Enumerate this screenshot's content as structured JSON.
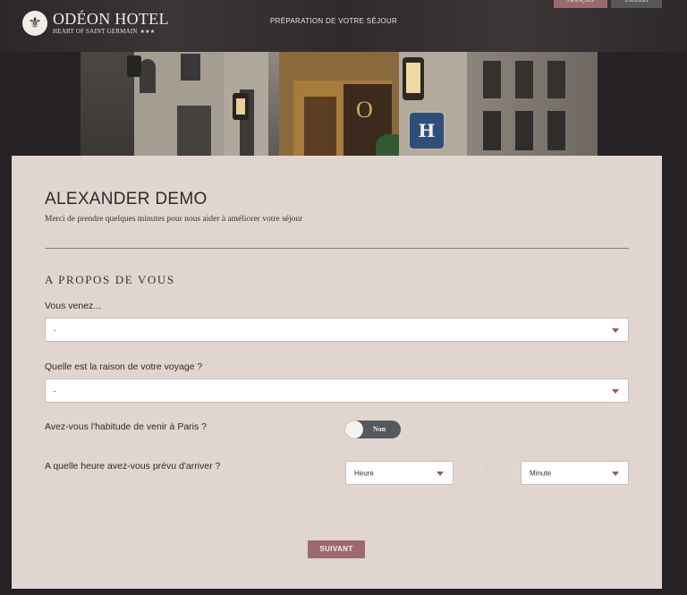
{
  "header": {
    "logo_mark": "⚜",
    "logo_title": "ODÉON HOTEL",
    "logo_subtitle": "HEART OF SAINT GERMAIN",
    "logo_stars": "★★★",
    "title": "PRÉPARATION DE VOTRE SÉJOUR",
    "lang_fr": "FRANÇAIS",
    "lang_en": "ENGLISH"
  },
  "photo": {
    "door_text": "O",
    "sign_letter": "H"
  },
  "form": {
    "guest_name": "ALEXANDER DEMO",
    "intro": "Merci de prendre quelques minutes pour nous aider à améliorer votre séjour",
    "section_title": "A PROPOS DE VOUS",
    "origin": {
      "label": "Vous venez...",
      "value": "-"
    },
    "reason": {
      "label": "Quelle est la raison de votre voyage ?",
      "value": "-"
    },
    "habit": {
      "label": "Avez-vous l'habitude de venir à Paris ?",
      "toggle_label": "Non"
    },
    "arrival": {
      "label": "A quelle heure avez-vous prévu d'arriver ?",
      "hour": "Heure",
      "minute": "Minute",
      "separator": ":"
    },
    "next_label": "SUIVANT"
  },
  "colors": {
    "accent": "#9c6a6e",
    "panel": "#e1d5cf",
    "header": "#2c2829",
    "toggle": "#55585c"
  }
}
